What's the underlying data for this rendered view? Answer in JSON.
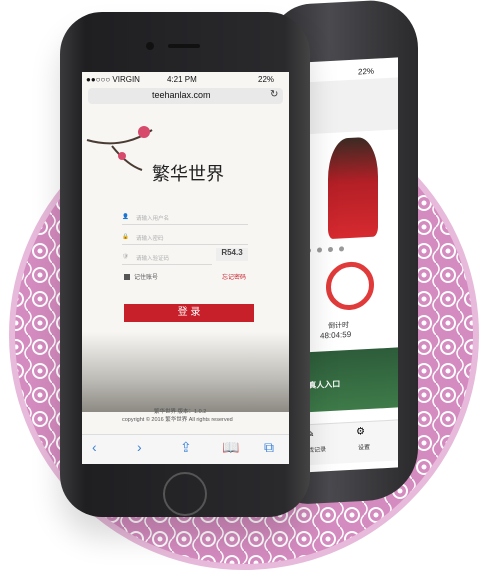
{
  "front": {
    "status": {
      "carrier": "●●○○○ VIRGIN",
      "time": "4:21 PM",
      "battery": "22%"
    },
    "url": "teehanlax.com",
    "logo": "繁华世界",
    "username_placeholder": "请输入用户名",
    "password_placeholder": "请输入密码",
    "captcha_placeholder": "请输入验证码",
    "captcha_code": "R54.3",
    "remember_label": "记住账号",
    "forgot_label": "忘记密码",
    "login_label": "登 录",
    "footer_version": "繁华世界  版本：1.0.2",
    "footer_copyright": "copyright © 2016 繁华世界  All rights reserved",
    "toolbar": {
      "back": "‹",
      "forward": "›",
      "share": "⇪",
      "bookmarks": "📖",
      "tabs": "⧉"
    }
  },
  "back": {
    "status": {
      "battery": "22%"
    },
    "timer_label": "倒计时",
    "timer_value": "48:04:59",
    "banner_text": "G真人入口",
    "tabs": [
      {
        "label": "游戏记录"
      },
      {
        "label": "设置"
      }
    ]
  },
  "colors": {
    "accent": "#c8202a",
    "medallion": "#d996c6",
    "link": "#3b82d8"
  }
}
